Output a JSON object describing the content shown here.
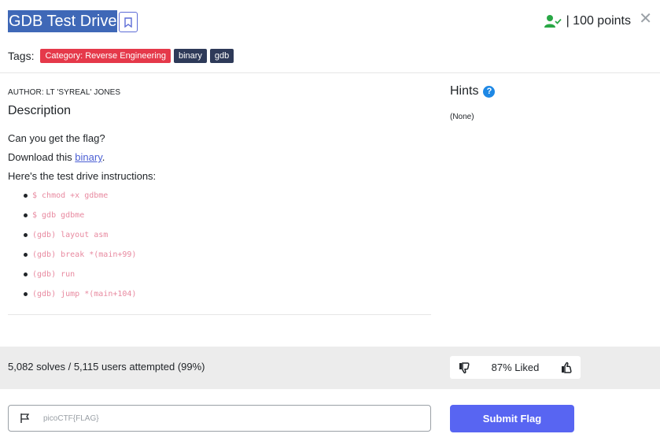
{
  "header": {
    "title": "GDB Test Drive",
    "points": "| 100 points",
    "close": "✕"
  },
  "tags": {
    "label": "Tags:",
    "items": [
      "Category: Reverse Engineering",
      "binary",
      "gdb"
    ]
  },
  "challenge": {
    "author": "AUTHOR: LT 'SYREAL' JONES",
    "description_heading": "Description",
    "line1": "Can you get the flag?",
    "line2_prefix": "Download this ",
    "line2_link": "binary",
    "line2_suffix": ".",
    "line3": "Here's the test drive instructions:",
    "commands": [
      "$ chmod +x gdbme",
      "$ gdb gdbme",
      "(gdb) layout asm",
      "(gdb) break *(main+99)",
      "(gdb) run",
      "(gdb) jump *(main+104)"
    ]
  },
  "hints": {
    "heading": "Hints",
    "help_glyph": "?",
    "none": "(None)"
  },
  "stats": {
    "solves": "5,082 solves / 5,115 users attempted (99%)",
    "liked": "87% Liked"
  },
  "flag": {
    "placeholder": "picoCTF{FLAG}",
    "submit_label": "Submit Flag"
  },
  "colors": {
    "accent": "#5865f2",
    "category_tag": "#e5394a",
    "dark_tag": "#2e3a59",
    "user_check": "#28a745"
  }
}
